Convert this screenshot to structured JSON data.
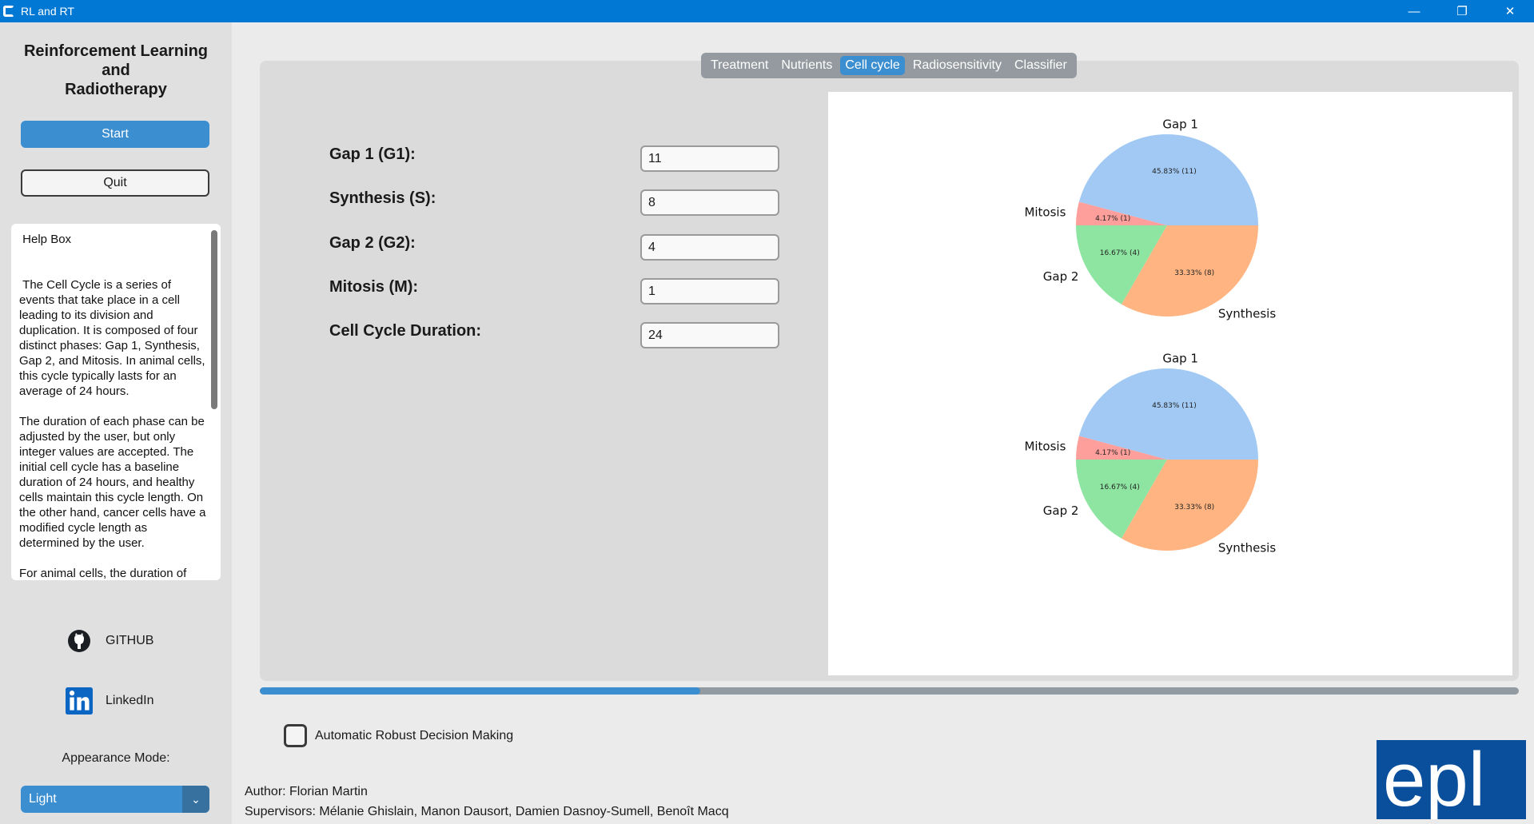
{
  "window": {
    "title": "RL and RT",
    "minimize": "—",
    "maximize": "❐",
    "close": "✕"
  },
  "sidebar": {
    "title_lines": [
      "Reinforcement Learning",
      "and",
      "Radiotherapy"
    ],
    "start_label": "Start",
    "quit_label": "Quit",
    "help_box": " Help Box\n\n\n The Cell Cycle is a series of events that take place in a cell leading to its division and duplication. It is composed of four distinct phases: Gap 1, Synthesis, Gap 2, and Mitosis. In animal cells, this cycle typically lasts for an average of 24 hours.\n\nThe duration of each phase can be adjusted by the user, but only integer values are accepted. The initial cell cycle has a baseline duration of 24 hours, and healthy cells maintain this cycle length. On the other hand, cancer cells have a modified cycle length as determined by the user.\n\nFor animal cells, the duration of",
    "github_label": "GITHUB",
    "linkedin_label": "LinkedIn",
    "appearance_label": "Appearance Mode:",
    "appearance_value": "Light"
  },
  "tabs": [
    {
      "label": "Treatment",
      "active": false
    },
    {
      "label": "Nutrients",
      "active": false
    },
    {
      "label": "Cell cycle",
      "active": true
    },
    {
      "label": "Radiosensitivity",
      "active": false
    },
    {
      "label": "Classifier",
      "active": false
    }
  ],
  "form": {
    "g1_label": "Gap 1 (G1):",
    "g1_value": "11",
    "s_label": "Synthesis (S):",
    "s_value": "8",
    "g2_label": "Gap 2 (G2):",
    "g2_value": "4",
    "m_label": "Mitosis (M):",
    "m_value": "1",
    "duration_label": "Cell Cycle Duration:",
    "duration_value": "24"
  },
  "chart_data": [
    {
      "type": "pie",
      "categories": [
        "Gap 1",
        "Mitosis",
        "Gap 2",
        "Synthesis"
      ],
      "values": [
        11,
        1,
        4,
        8
      ],
      "pct_labels": [
        "45.83%  (11)",
        "4.17%  (1)",
        "16.67%  (4)",
        "33.33%  (8)"
      ],
      "colors": [
        "#a1c9f4",
        "#ff9f9b",
        "#8de5a1",
        "#ffb482"
      ]
    },
    {
      "type": "pie",
      "categories": [
        "Gap 1",
        "Mitosis",
        "Gap 2",
        "Synthesis"
      ],
      "values": [
        11,
        1,
        4,
        8
      ],
      "pct_labels": [
        "45.83%  (11)",
        "4.17%  (1)",
        "16.67%  (4)",
        "33.33%  (8)"
      ],
      "colors": [
        "#a1c9f4",
        "#ff9f9b",
        "#8de5a1",
        "#ffb482"
      ]
    }
  ],
  "progress": {
    "fraction": 0.35
  },
  "checkbox_label": "Automatic Robust Decision Making",
  "credits": {
    "author": "Author: Florian Martin",
    "supervisors": "Supervisors: Mélanie Ghislain, Manon Dausort, Damien Dasnoy-Sumell, Benoît Macq"
  },
  "logo_text": "epl",
  "colors": {
    "accent": "#3b8ed0",
    "titlebar": "#0078d4",
    "logo": "#0a4f9c"
  }
}
